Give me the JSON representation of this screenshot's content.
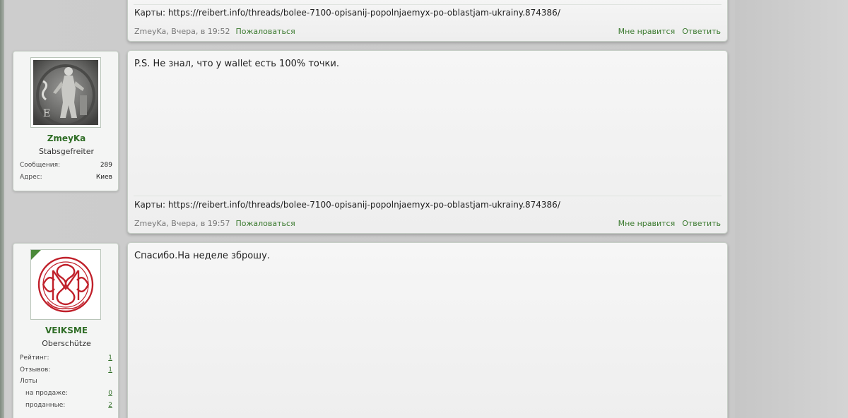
{
  "posts": [
    {
      "signature": "Карты: https://reibert.info/threads/bolee-7100-opisanij-popolnjaemyx-po-oblastjam-ukrainy.874386/",
      "author": "ZmeyKa",
      "time": ", Вчера, в 19:52",
      "report_label": "Пожаловаться",
      "like_label": "Мне нравится",
      "reply_label": "Ответить"
    },
    {
      "user": {
        "name": "ZmeyKa",
        "title": "Stabsgefreiter",
        "stats": [
          {
            "label": "Сообщения:",
            "value": "289"
          },
          {
            "label": "Адрес:",
            "value": "Киев"
          }
        ],
        "avatar_icon": "figure-portrait-icon"
      },
      "body": "P.S. Не знал, что у wallet есть 100% точки.",
      "signature": "Карты: https://reibert.info/threads/bolee-7100-opisanij-popolnjaemyx-po-oblastjam-ukrainy.874386/",
      "author": "ZmeyKa",
      "time": ", Вчера, в 19:57",
      "report_label": "Пожаловаться",
      "like_label": "Мне нравится",
      "reply_label": "Ответить"
    },
    {
      "user": {
        "name": "VEIKSME",
        "title": "Oberschütze",
        "stats": [
          {
            "label": "Рейтинг:",
            "value": "1"
          },
          {
            "label": "Отзывов:",
            "value": "1"
          },
          {
            "label": "Лоты",
            "value": ""
          },
          {
            "label": "на продаже:",
            "value": "0"
          },
          {
            "label": "проданные:",
            "value": "2"
          }
        ],
        "avatar_icon": "monogram-logo-icon",
        "online": true
      },
      "body": "Спасибо.На неделе зброшу."
    }
  ],
  "colors": {
    "accent_green": "#2f6d26",
    "link_green": "#3b7a2f",
    "monogram_red": "#c0202a"
  }
}
